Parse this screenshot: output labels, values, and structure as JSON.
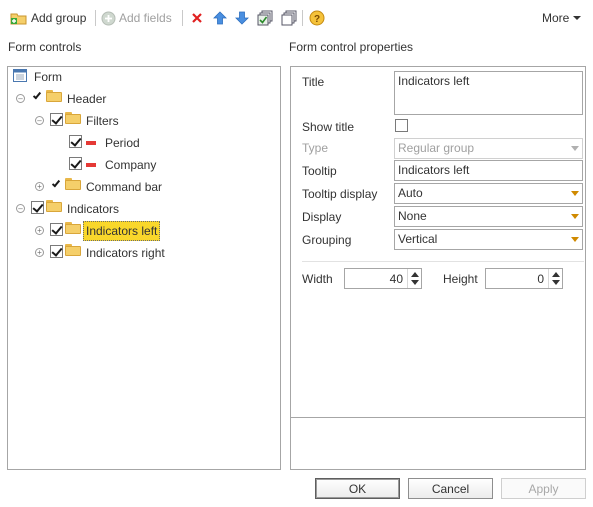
{
  "toolbar": {
    "add_group": "Add group",
    "add_fields": "Add fields",
    "more": "More",
    "icons": [
      "add-group-icon",
      "add-fields-icon",
      "delete-icon",
      "move-up-icon",
      "move-down-icon",
      "select-all-icon",
      "copy-icon",
      "help-icon"
    ]
  },
  "left": {
    "title": "Form controls"
  },
  "tree": {
    "root": "Form",
    "header": "Header",
    "filters": "Filters",
    "period": "Period",
    "company": "Company",
    "command_bar": "Command bar",
    "indicators": "Indicators",
    "indicators_left": "Indicators left",
    "indicators_right": "Indicators right"
  },
  "right": {
    "title": "Form control properties"
  },
  "props": {
    "title_label": "Title",
    "title_value": "Indicators left",
    "show_title_label": "Show title",
    "type_label": "Type",
    "type_value": "Regular group",
    "tooltip_label": "Tooltip",
    "tooltip_value": "Indicators left",
    "tooltip_display_label": "Tooltip display",
    "tooltip_display_value": "Auto",
    "display_label": "Display",
    "display_value": "None",
    "grouping_label": "Grouping",
    "grouping_value": "Vertical",
    "width_label": "Width",
    "width_value": "40",
    "height_label": "Height",
    "height_value": "0"
  },
  "buttons": {
    "ok": "OK",
    "cancel": "Cancel",
    "apply": "Apply"
  },
  "colors": {
    "selection": "#f9d72b",
    "delete": "#e02020",
    "arrows": "#3a7fd5"
  }
}
